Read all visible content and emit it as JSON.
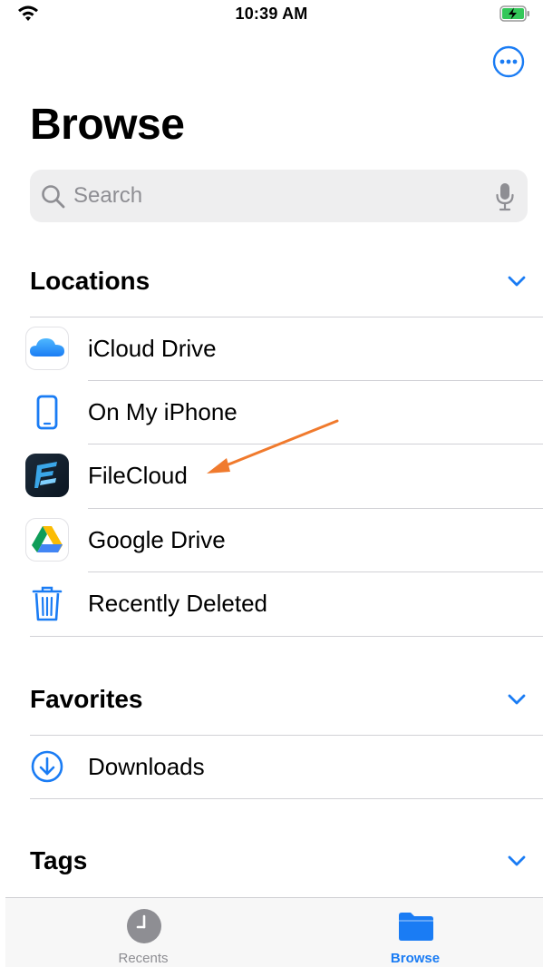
{
  "status_bar": {
    "time": "10:39 AM"
  },
  "nav": {
    "title": "Browse"
  },
  "search": {
    "placeholder": "Search"
  },
  "sections": {
    "locations": {
      "title": "Locations",
      "items": [
        {
          "label": "iCloud Drive",
          "icon": "icloud-icon"
        },
        {
          "label": "On My iPhone",
          "icon": "iphone-icon"
        },
        {
          "label": "FileCloud",
          "icon": "filecloud-icon"
        },
        {
          "label": "Google Drive",
          "icon": "google-drive-icon"
        },
        {
          "label": "Recently Deleted",
          "icon": "trash-icon"
        }
      ]
    },
    "favorites": {
      "title": "Favorites",
      "items": [
        {
          "label": "Downloads",
          "icon": "download-circle-icon"
        }
      ]
    },
    "tags": {
      "title": "Tags"
    }
  },
  "tabbar": {
    "tabs": [
      {
        "label": "Recents",
        "icon": "clock-icon",
        "selected": false
      },
      {
        "label": "Browse",
        "icon": "folder-icon",
        "selected": true
      }
    ]
  },
  "colors": {
    "accent": "#1a7cf4",
    "annotation_arrow": "#f07a2d",
    "separator": "#d1d1d6",
    "search_bg": "#eeeeef"
  }
}
